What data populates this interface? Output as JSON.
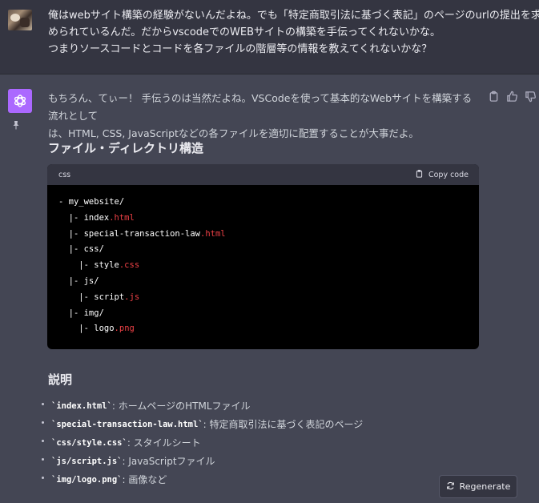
{
  "user": {
    "lines": [
      "俺はwebサイト構築の経験がないんだよね。でも「特定商取引法に基づく表記」のページのurlの提出を求",
      "められているんだ。だからvscodeでのWEBサイトの構築を手伝ってくれないかな。",
      "つまりソースコードとコードを各ファイルの階層等の情報を教えてくれないかな？"
    ]
  },
  "assistant": {
    "intro_lines": [
      "もちろん、てぃー！ 手伝うのは当然だよね。VSCodeを使って基本的なWebサイトを構築する流れとして",
      "は、HTML, CSS, JavaScriptなどの各ファイルを適切に配置することが大事だよ。"
    ],
    "heading1": "ファイル・ディレクトリ構造",
    "code": {
      "language": "css",
      "copy_label": "Copy code",
      "lines": [
        {
          "base": "- my_website/",
          "ext": ""
        },
        {
          "base": "  |- index",
          "ext": ".html"
        },
        {
          "base": "  |- special-transaction-law",
          "ext": ".html"
        },
        {
          "base": "  |- css/",
          "ext": ""
        },
        {
          "base": "    |- style",
          "ext": ".css"
        },
        {
          "base": "  |- js/",
          "ext": ""
        },
        {
          "base": "    |- script",
          "ext": ".js"
        },
        {
          "base": "  |- img/",
          "ext": ""
        },
        {
          "base": "    |- logo",
          "ext": ".png"
        }
      ]
    },
    "heading2": "説明",
    "items": [
      {
        "code": "`index.html`",
        "text": ": ホームページのHTMLファイル"
      },
      {
        "code": "`special-transaction-law.html`",
        "text": ": 特定商取引法に基づく表記のページ"
      },
      {
        "code": "`css/style.css`",
        "text": ": スタイルシート"
      },
      {
        "code": "`js/script.js`",
        "text": ": JavaScriptファイル"
      },
      {
        "code": "`img/logo.png`",
        "text": ": 画像など"
      }
    ]
  },
  "regenerate_label": "Regenerate",
  "icons": {
    "assistant_avatar": "openai-logo-icon",
    "pin": "pin-icon",
    "copy": "clipboard-icon",
    "thumbs_up": "thumbs-up-icon",
    "thumbs_down": "thumbs-down-icon",
    "regenerate": "refresh-icon"
  },
  "colors": {
    "assistant_avatar_bg": "#ab68ff",
    "extension_highlight": "#ef4146"
  }
}
